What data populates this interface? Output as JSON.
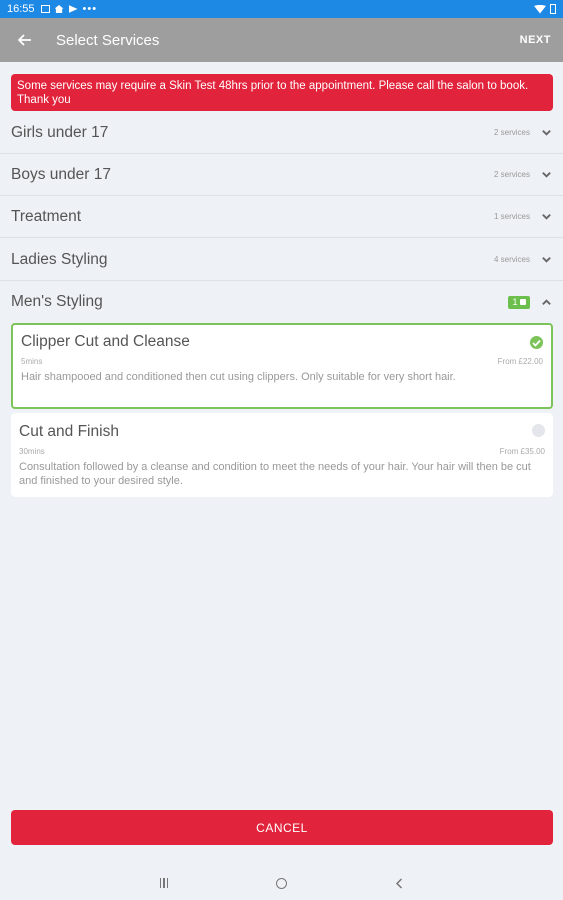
{
  "status_bar": {
    "time": "16:55",
    "dots": "•••"
  },
  "app_bar": {
    "back_icon": "arrow-left-icon",
    "title": "Select Services",
    "next_label": "NEXT"
  },
  "alert": {
    "text": "Some services may require a Skin Test 48hrs prior to the appointment. Please call the salon to book. Thank you"
  },
  "categories": [
    {
      "name": "Girls under 17",
      "count": "2 services",
      "expanded": false
    },
    {
      "name": "Boys under 17",
      "count": "2 services",
      "expanded": false
    },
    {
      "name": "Treatment",
      "count": "1 services",
      "expanded": false
    },
    {
      "name": "Ladies Styling",
      "count": "4 services",
      "expanded": false
    },
    {
      "name": "Men's Styling",
      "badge": "1",
      "expanded": true
    }
  ],
  "services": [
    {
      "name": "Clipper Cut and Cleanse",
      "duration": "5mins",
      "price": "From £22.00",
      "description": "Hair shampooed and conditioned then cut using clippers.  Only suitable for very short hair.",
      "selected": true
    },
    {
      "name": "Cut and Finish",
      "duration": "30mins",
      "price": "From £35.00",
      "description": "Consultation followed by a cleanse and condition to meet the needs of your hair.  Your hair will then be cut and finished to your desired style.",
      "selected": false
    }
  ],
  "cancel_label": "CANCEL",
  "colors": {
    "accent_red": "#e2233c",
    "select_green": "#7cc35a",
    "app_bar": "#9e9e9e",
    "status_bar": "#1e88e5"
  }
}
